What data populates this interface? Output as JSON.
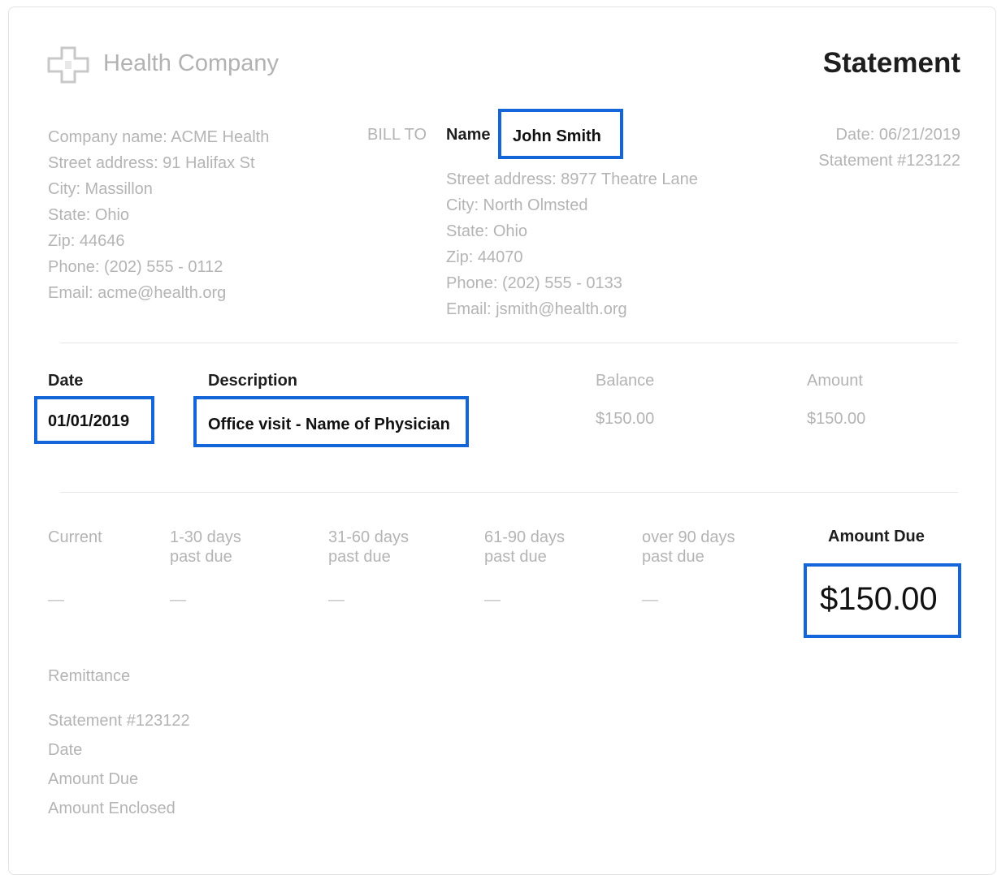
{
  "header": {
    "company": "Health Company",
    "title": "Statement",
    "logo_icon": "plus-cross-icon"
  },
  "from": {
    "lines": [
      "Company name: ACME Health",
      "Street address: 91 Halifax St",
      "City: Massillon",
      "State: Ohio",
      "Zip: 44646",
      "Phone: (202) 555 - 0112",
      "Email: acme@health.org"
    ]
  },
  "bill_to": {
    "label": "BILL TO",
    "name_label": "Name",
    "name_value": "John Smith",
    "lines": [
      "Street address: 8977 Theatre Lane",
      "City: North Olmsted",
      "State: Ohio",
      "Zip: 44070",
      "Phone: (202) 555 - 0133",
      "Email: jsmith@health.org"
    ]
  },
  "meta": {
    "date": "Date: 06/21/2019",
    "statement_no": "Statement #123122"
  },
  "items": {
    "headers": {
      "date": "Date",
      "description": "Description",
      "balance": "Balance",
      "amount": "Amount"
    },
    "rows": [
      {
        "date": "01/01/2019",
        "description": "Office visit - Name of Physician",
        "balance": "$150.00",
        "amount": "$150.00"
      }
    ]
  },
  "aging": {
    "columns": [
      {
        "label": "Current",
        "value": "—"
      },
      {
        "label": "1-30 days past due",
        "value": "—"
      },
      {
        "label": "31-60 days past due",
        "value": "—"
      },
      {
        "label": "61-90 days past due",
        "value": "—"
      },
      {
        "label": "over 90 days past due",
        "value": "—"
      }
    ],
    "amount_due_label": "Amount Due",
    "amount_due_value": "$150.00"
  },
  "remittance": {
    "title": "Remittance",
    "lines": [
      "Statement #123122",
      "Date",
      "Amount Due",
      "Amount Enclosed"
    ]
  },
  "colors": {
    "highlight": "#1466d8",
    "dark_text": "#1e1e1e",
    "muted_text": "#b4b4b4"
  }
}
